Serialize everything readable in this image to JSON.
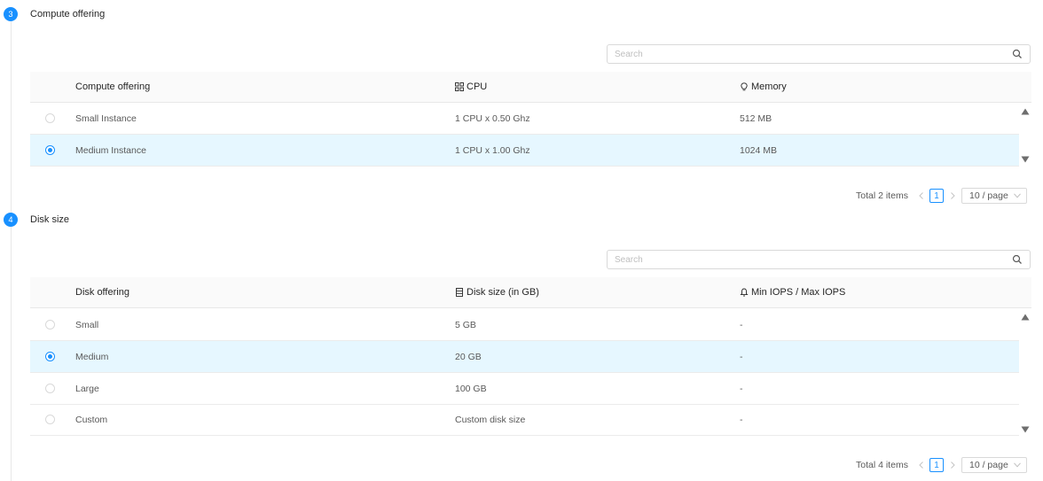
{
  "steps": [
    {
      "number": "3",
      "title": "Compute offering",
      "search_placeholder": "Search",
      "columns": [
        "Compute offering",
        "CPU",
        "Memory"
      ],
      "rows": [
        {
          "name": "Small Instance",
          "col2": "1 CPU x 0.50 Ghz",
          "col3": "512 MB",
          "selected": false
        },
        {
          "name": "Medium Instance",
          "col2": "1 CPU x 1.00 Ghz",
          "col3": "1024 MB",
          "selected": true
        }
      ],
      "pagination": {
        "total": "Total 2 items",
        "page": "1",
        "page_size": "10 / page"
      }
    },
    {
      "number": "4",
      "title": "Disk size",
      "search_placeholder": "Search",
      "columns": [
        "Disk offering",
        "Disk size (in GB)",
        "Min IOPS / Max IOPS"
      ],
      "rows": [
        {
          "name": "Small",
          "col2": "5 GB",
          "col3": "-",
          "selected": false
        },
        {
          "name": "Medium",
          "col2": "20 GB",
          "col3": "-",
          "selected": true
        },
        {
          "name": "Large",
          "col2": "100 GB",
          "col3": "-",
          "selected": false
        },
        {
          "name": "Custom",
          "col2": "Custom disk size",
          "col3": "-",
          "selected": false
        }
      ],
      "pagination": {
        "total": "Total 4 items",
        "page": "1",
        "page_size": "10 / page"
      }
    }
  ],
  "icons": {
    "search": "search-icon",
    "cpu": "grid-icon",
    "memory": "bulb-icon",
    "disk_size": "disk-icon",
    "iops": "bell-icon"
  },
  "colors": {
    "accent": "#1890ff",
    "selected_row": "#e6f7ff",
    "header_bg": "#fafafa"
  }
}
